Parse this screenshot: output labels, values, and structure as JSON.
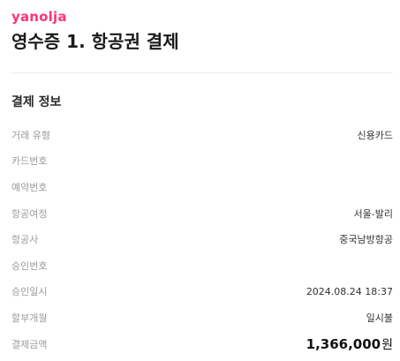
{
  "brand": {
    "logo_text": "yanolja",
    "accent_color": "#ff3478"
  },
  "header": {
    "title": "영수증 1. 항공권 결제"
  },
  "payment_info": {
    "section_title": "결제 정보",
    "rows": [
      {
        "label": "거래 유형",
        "value": ""
      },
      {
        "label": "카드번호",
        "value": ""
      },
      {
        "label": "예약번호",
        "value": ""
      },
      {
        "label": "항공여정",
        "value": "서울-발리"
      },
      {
        "label": "항공사",
        "value": "중국남방항공"
      },
      {
        "label": "승인번호",
        "value": ""
      },
      {
        "label": "승인일시",
        "value": "2024.08.24 18:37"
      },
      {
        "label": "할부개월",
        "value": "일시불"
      },
      {
        "label": "결제금액",
        "value": "1,366,000",
        "unit": "원"
      }
    ],
    "transaction_type_value": "신용카드"
  }
}
